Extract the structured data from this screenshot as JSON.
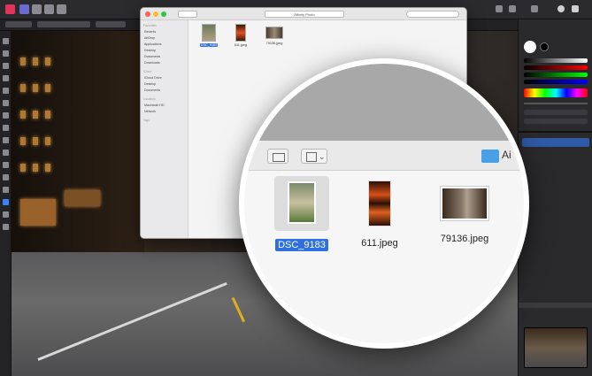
{
  "app": {
    "persona_colors": [
      "#e0345a",
      "#8a8ae0",
      "#9a9aa0",
      "#9a9aa0",
      "#9a9aa0"
    ]
  },
  "finder": {
    "sidebar": {
      "favorites_header": "Favourites",
      "favorites": [
        "Recents",
        "AirDrop",
        "Applications",
        "Desktop",
        "Documents",
        "Downloads"
      ],
      "icloud_header": "iCloud",
      "icloud": [
        "iCloud Drive",
        "Desktop",
        "Documents"
      ],
      "locations_header": "Locations",
      "locations": [
        "Macintosh HD",
        "Network"
      ],
      "tags_header": "Tags"
    },
    "path_label": "Affinity Photo"
  },
  "files": [
    {
      "name": "DSC_9183",
      "selected": true
    },
    {
      "name": "611.jpeg",
      "selected": false
    },
    {
      "name": "79136.jpeg",
      "selected": false
    }
  ],
  "magnifier": {
    "folder_label": "Ai"
  },
  "panel": {
    "swatch_colors": [
      "#f5f5f5",
      "#ff3b30",
      "#34c759",
      "#007aff",
      "#ff00ff"
    ]
  }
}
